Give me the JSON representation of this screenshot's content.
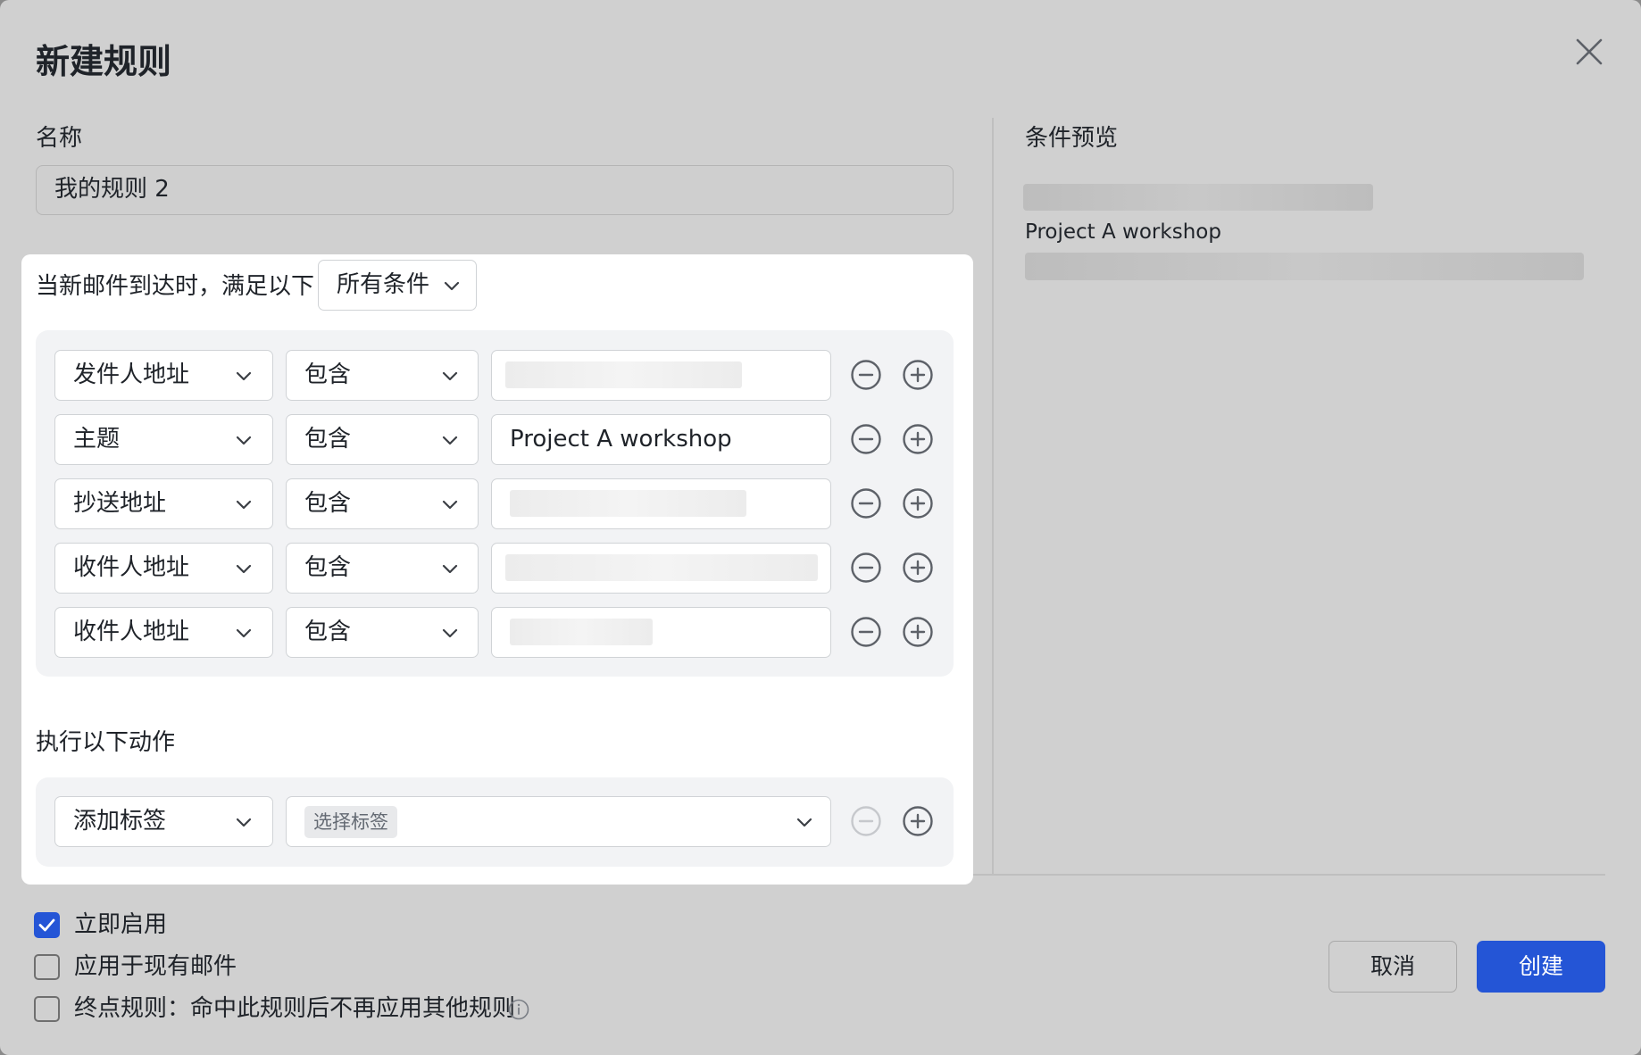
{
  "dialog": {
    "title": "新建规则"
  },
  "name": {
    "label": "名称",
    "value": "我的规则 2"
  },
  "preview": {
    "label": "条件预览",
    "visible_text": "Project A workshop"
  },
  "conditions": {
    "intro": "当新邮件到达时，满足以下",
    "match_mode": "所有条件",
    "rows": [
      {
        "field": "发件人地址",
        "operator": "包含",
        "value": ""
      },
      {
        "field": "主题",
        "operator": "包含",
        "value": "Project A workshop"
      },
      {
        "field": "抄送地址",
        "operator": "包含",
        "value": ""
      },
      {
        "field": "收件人地址",
        "operator": "包含",
        "value": ""
      },
      {
        "field": "收件人地址",
        "operator": "包含",
        "value": ""
      }
    ]
  },
  "actions": {
    "label": "执行以下动作",
    "rows": [
      {
        "action": "添加标签",
        "placeholder": "选择标签"
      }
    ]
  },
  "options": {
    "enable_now": {
      "label": "立即启用",
      "checked": true
    },
    "apply_existing": {
      "label": "应用于现有邮件",
      "checked": false
    },
    "stop_rule": {
      "label": "终点规则：命中此规则后不再应用其他规则",
      "checked": false
    }
  },
  "buttons": {
    "cancel": "取消",
    "create": "创建"
  },
  "colors": {
    "primary": "#2455d6",
    "overlay": "#d0d0d0"
  }
}
